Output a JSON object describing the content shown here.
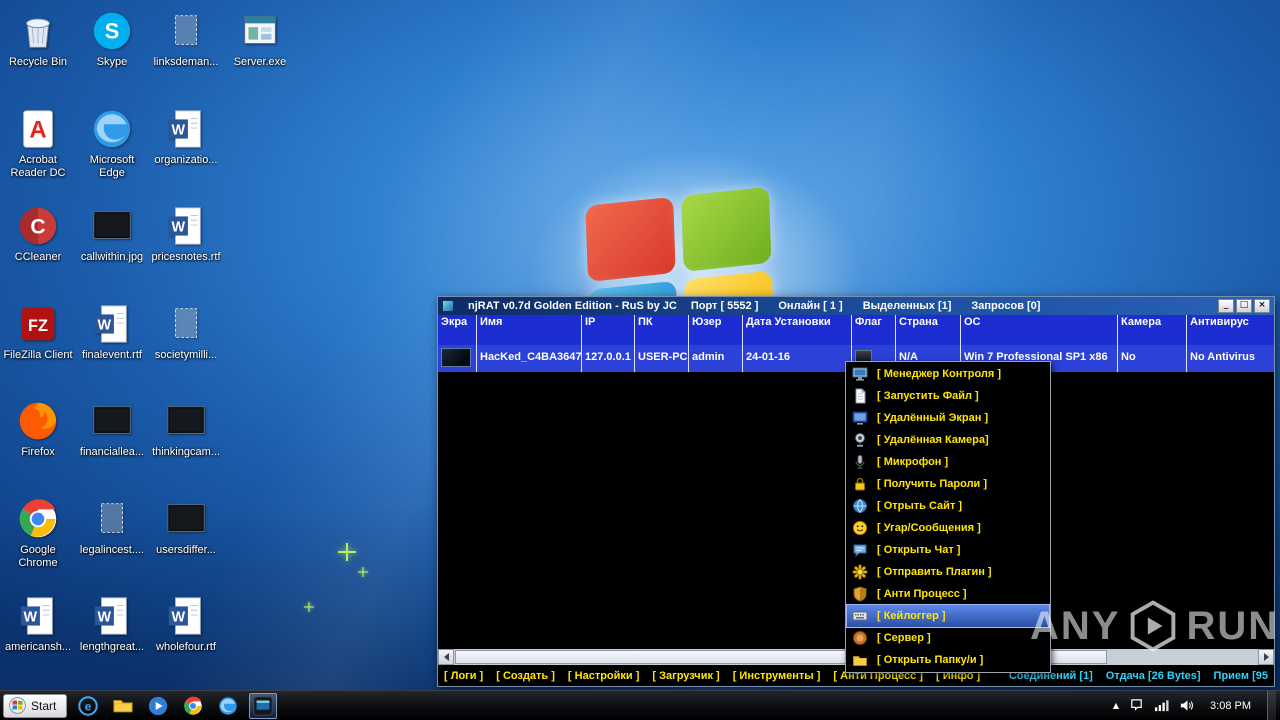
{
  "desktop": {
    "icons": [
      {
        "label": "Recycle Bin",
        "icon": "recycle-bin",
        "col": 1,
        "row": 1
      },
      {
        "label": "Skype",
        "icon": "skype",
        "col": 2,
        "row": 1
      },
      {
        "label": "linksdeman...",
        "icon": "ghost-doc",
        "col": 3,
        "row": 1
      },
      {
        "label": "Server.exe",
        "icon": "server-window",
        "col": 4,
        "row": 1
      },
      {
        "label": "Acrobat Reader DC",
        "icon": "acrobat",
        "col": 1,
        "row": 2
      },
      {
        "label": "Microsoft Edge",
        "icon": "edge-browser",
        "col": 2,
        "row": 2
      },
      {
        "label": "organizatio...",
        "icon": "word-doc",
        "col": 3,
        "row": 2
      },
      {
        "label": "CCleaner",
        "icon": "ccleaner",
        "col": 1,
        "row": 3
      },
      {
        "label": "callwithin.jpg",
        "icon": "image-file",
        "col": 2,
        "row": 3
      },
      {
        "label": "pricesnotes.rtf",
        "icon": "word-doc",
        "col": 3,
        "row": 3
      },
      {
        "label": "FileZilla Client",
        "icon": "filezilla",
        "col": 1,
        "row": 4
      },
      {
        "label": "finalevent.rtf",
        "icon": "word-doc",
        "col": 2,
        "row": 4
      },
      {
        "label": "societymilli...",
        "icon": "ghost-doc",
        "col": 3,
        "row": 4
      },
      {
        "label": "Firefox",
        "icon": "firefox",
        "col": 1,
        "row": 5
      },
      {
        "label": "financiallea...",
        "icon": "image-file",
        "col": 2,
        "row": 5
      },
      {
        "label": "thinkingcam...",
        "icon": "image-file",
        "col": 3,
        "row": 5
      },
      {
        "label": "Google Chrome",
        "icon": "chrome-browser",
        "col": 1,
        "row": 6
      },
      {
        "label": "legalincest....",
        "icon": "ghost-doc",
        "col": 2,
        "row": 6
      },
      {
        "label": "usersdiffer...",
        "icon": "image-file",
        "col": 3,
        "row": 6
      },
      {
        "label": "americansh...",
        "icon": "word-doc",
        "col": 1,
        "row": 7
      },
      {
        "label": "lengthgreat...",
        "icon": "word-doc",
        "col": 2,
        "row": 7
      },
      {
        "label": "wholefour.rtf",
        "icon": "word-doc",
        "col": 3,
        "row": 7
      }
    ]
  },
  "njrat": {
    "titlebar": {
      "title": "njRAT v0.7d Golden Edition - RuS by JC",
      "stats": [
        "Порт [ 5552 ]",
        "Онлайн [ 1 ]",
        "Выделенных [1]",
        "Запросов [0]"
      ],
      "window_buttons": [
        {
          "glyph": "_",
          "name": "minimize"
        },
        {
          "glyph": "□",
          "name": "maximize"
        },
        {
          "glyph": "×",
          "name": "close"
        }
      ]
    },
    "table": {
      "columns": [
        "Экра",
        "Имя",
        "IP",
        "ПК",
        "Юзер",
        "Дата Установки",
        "Флаг",
        "Страна",
        "ОС",
        "Камера",
        "Антивирус"
      ],
      "row": {
        "name": "HacKed_C4BA3647",
        "ip": "127.0.0.1",
        "pc": "USER-PC",
        "user": "admin",
        "install_date": "24-01-16",
        "country": "N/A",
        "os": "Win 7 Professional SP1 x86",
        "camera": "No",
        "antivirus": "No Antivirus"
      }
    },
    "context_menu": [
      {
        "icon": "control-manager-icon",
        "label": "[ Менеджер Контроля ]"
      },
      {
        "icon": "run-file-icon",
        "label": "[ Запустить Файл ]"
      },
      {
        "icon": "remote-desktop-icon",
        "label": "[ Удалённый Экран ]"
      },
      {
        "icon": "remote-camera-icon",
        "label": "[ Удалённая Камера]"
      },
      {
        "icon": "microphone-icon",
        "label": "[ Микрофон ]"
      },
      {
        "icon": "passwords-icon",
        "label": "[ Получить Пароли ]"
      },
      {
        "icon": "open-site-icon",
        "label": "[ Отрыть Сайт ]"
      },
      {
        "icon": "fun-messages-icon",
        "label": "[ Угар/Сообщения ]"
      },
      {
        "icon": "chat-icon",
        "label": "[ Открыть Чат ]"
      },
      {
        "icon": "plugin-icon",
        "label": "[ Отправить Плагин ]"
      },
      {
        "icon": "anti-process-icon",
        "label": "[ Анти Процесс ]"
      },
      {
        "icon": "keylogger-icon",
        "label": "[ Кейлоггер ]",
        "selected": true
      },
      {
        "icon": "server-icon",
        "label": "[ Сервер ]"
      },
      {
        "icon": "open-folder-icon",
        "label": "[ Открыть Папку/и ]"
      }
    ],
    "footer": {
      "buttons": [
        "[ Логи ]",
        "[ Создать ]",
        "[ Настройки ]",
        "[ Загрузчик ]",
        "[ Инструменты ]",
        "[ Анти Процесс ]",
        "[ Инфо ]"
      ],
      "stats": [
        "Соединений [1]",
        "Отдача [26 Bytes]",
        "Прием [95"
      ]
    }
  },
  "watermark": {
    "left": "ANY",
    "right": "RUN"
  },
  "taskbar": {
    "start_label": "Start",
    "buttons": [
      {
        "icon": "ie-icon",
        "name": "internet-explorer"
      },
      {
        "icon": "explorer-icon",
        "name": "windows-explorer"
      },
      {
        "icon": "wmp-icon",
        "name": "media-player"
      },
      {
        "icon": "chrome-icon",
        "name": "google-chrome"
      },
      {
        "icon": "edge-icon",
        "name": "microsoft-edge"
      },
      {
        "icon": "njrat-icon",
        "name": "njrat",
        "active": true
      }
    ],
    "tray": {
      "clock": "3:08 PM"
    }
  }
}
